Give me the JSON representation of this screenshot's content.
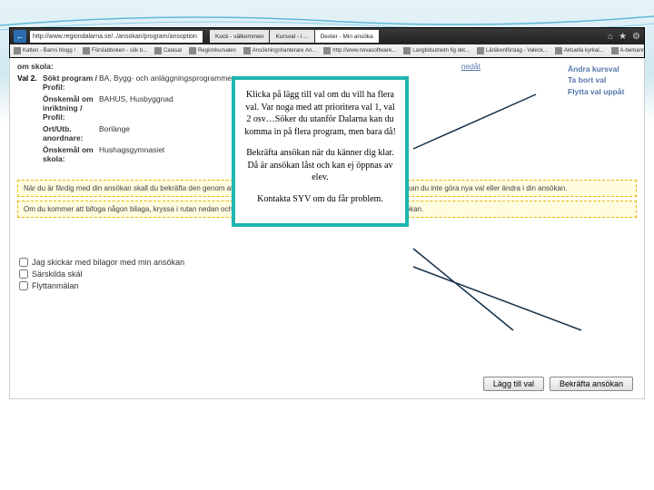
{
  "browser": {
    "url": "http://www.regiondalarna.se/../ansokan/program/ansoption",
    "tabs": [
      {
        "label": "Kock - välkommen",
        "active": false
      },
      {
        "label": "Kursval - i ...",
        "active": false
      },
      {
        "label": "Dexter - Min ansöka",
        "active": true
      }
    ],
    "bookmarks": [
      "Katten - Barns blogg !",
      "Förslabboken - sök b...",
      "Calasal",
      "Regionkurvalen",
      "Ansökningshanterare An...",
      "http://www.novasoftware...",
      "Langtidsutredn fig det...",
      "Lärlärenförslag - Valeck...",
      "Aktuella kyrkal...",
      "A-bemannadkurskarpe..."
    ]
  },
  "page": {
    "top_link": "nedåt",
    "val_row": {
      "num": "Val 2.",
      "label": "Sökt program / Profil:",
      "value": "BA, Bygg- och anläggningsprogrammet"
    },
    "rows": [
      {
        "label": "Önskemål om inriktning / Profil:",
        "value": "BAHUS, Husbyggnad"
      },
      {
        "label": "Ort/Utb. anordnare:",
        "value": "Borlänge"
      },
      {
        "label": "Önskemål om skola:",
        "value": "Hushagsgymnasiet"
      }
    ],
    "side_links": [
      "Ändra kursval",
      "Ta bort val",
      "Flytta val uppåt"
    ],
    "hint1": "När du är färdig med din ansökan skall du bekräfta den genom att klicka på knappen. När du har bekräftat din ansökan kan du inte göra nya val eller ändra i din ansökan.",
    "hint2": "Om du kommer att bifoga någon bilaga, kryssa i rutan nedan och skicka bilagan tillsammans med din underskrivna ansökan.",
    "checks": [
      "Jag skickar med bilagor med min ansökan",
      "Särskilda skäl",
      "Flyttanmälan"
    ],
    "buttons": {
      "add": "Lägg till val",
      "confirm": "Bekräfta ansökan"
    }
  },
  "callout": {
    "p1": "Klicka på lägg till val om du vill ha flera val. Var noga med att prioritera val 1, val 2 osv…Söker du utanför Dalarna kan du komma in på flera program, men bara då!",
    "p2": "Bekräfta ansökan när du känner dig klar. Då är ansökan låst och kan ej öppnas av elev.",
    "p3": "Kontakta SYV om du får problem."
  }
}
